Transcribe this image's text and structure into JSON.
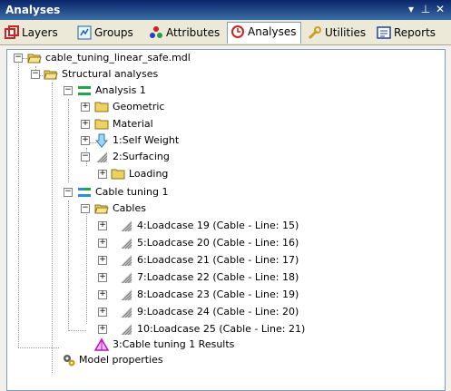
{
  "titlebar": {
    "title": "Analyses",
    "dropdown_glyph": "▾",
    "pin_glyph": "⊥",
    "close_glyph": "✕"
  },
  "tabs": [
    {
      "label": "Layers",
      "icon": "layers-icon"
    },
    {
      "label": "Groups",
      "icon": "groups-icon"
    },
    {
      "label": "Attributes",
      "icon": "attributes-icon"
    },
    {
      "label": "Analyses",
      "icon": "analyses-icon",
      "active": true
    },
    {
      "label": "Utilities",
      "icon": "utilities-icon"
    },
    {
      "label": "Reports",
      "icon": "reports-icon"
    }
  ],
  "tree": {
    "root": "cable_tuning_linear_safe.mdl",
    "structural": "Structural analyses",
    "analysis1": "Analysis 1",
    "geometric": "Geometric",
    "material": "Material",
    "self_weight": "1:Self Weight",
    "surfacing": "2:Surfacing",
    "loading": "Loading",
    "cable_tuning": "Cable tuning 1",
    "cables": "Cables",
    "loadcases": [
      "4:Loadcase 19 (Cable - Line: 15)",
      "5:Loadcase 20 (Cable - Line: 16)",
      "6:Loadcase 21 (Cable - Line: 17)",
      "7:Loadcase 22 (Cable - Line: 18)",
      "8:Loadcase 23 (Cable - Line: 19)",
      "9:Loadcase 24 (Cable - Line: 20)",
      "10:Loadcase 25 (Cable - Line: 21)"
    ],
    "results": "3:Cable tuning 1 Results",
    "model_props": "Model properties"
  },
  "colors": {
    "title_bg": "#0a246a",
    "folder": "#f0d060",
    "analysis_green": "#1fa64a",
    "cable_blue": "#2a8fd8",
    "results_magenta": "#c010c0"
  }
}
